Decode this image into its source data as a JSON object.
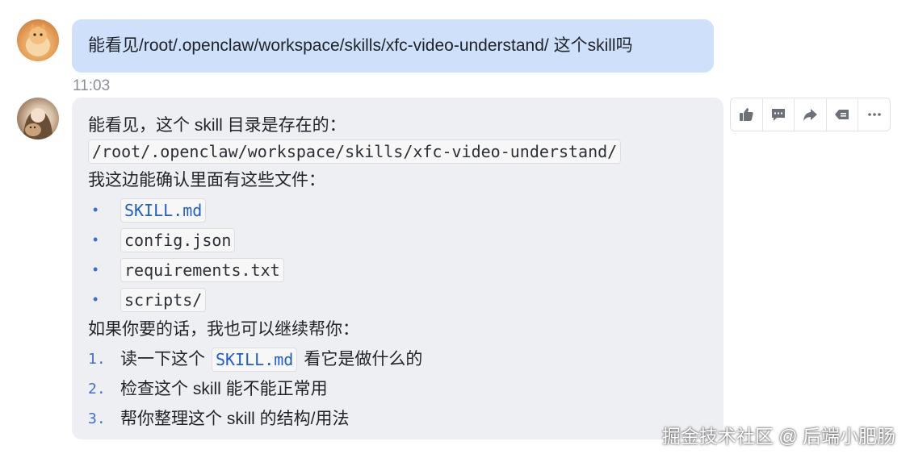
{
  "user_message": {
    "text": "能看见/root/.openclaw/workspace/skills/xfc-video-understand/ 这个skill吗",
    "time": "11:03"
  },
  "bot_message": {
    "intro": "能看见，这个 skill 目录是存在的：",
    "path": "/root/.openclaw/workspace/skills/xfc-video-understand/",
    "files_intro": "我这边能确认里面有这些文件：",
    "files": [
      "SKILL.md",
      "config.json",
      "requirements.txt",
      "scripts/"
    ],
    "help_intro": "如果你要的话，我也可以继续帮你：",
    "help_items": [
      {
        "num": "1.",
        "pre": "读一下这个",
        "code": "SKILL.md",
        "post": "看它是做什么的"
      },
      {
        "num": "2.",
        "text": "检查这个 skill 能不能正常用"
      },
      {
        "num": "3.",
        "text": "帮你整理这个 skill 的结构/用法"
      }
    ]
  },
  "actions": {
    "icons": [
      "thumbs-up-icon",
      "comment-icon",
      "forward-icon",
      "delete-icon",
      "more-icon"
    ]
  },
  "watermark": "掘金技术社区 @ 后端小肥肠",
  "colors": {
    "user_bubble": "#cfe0fb",
    "bot_bubble": "#eeeff2",
    "link_code": "#1f5fc4",
    "list_marker": "#3c6fd1"
  }
}
